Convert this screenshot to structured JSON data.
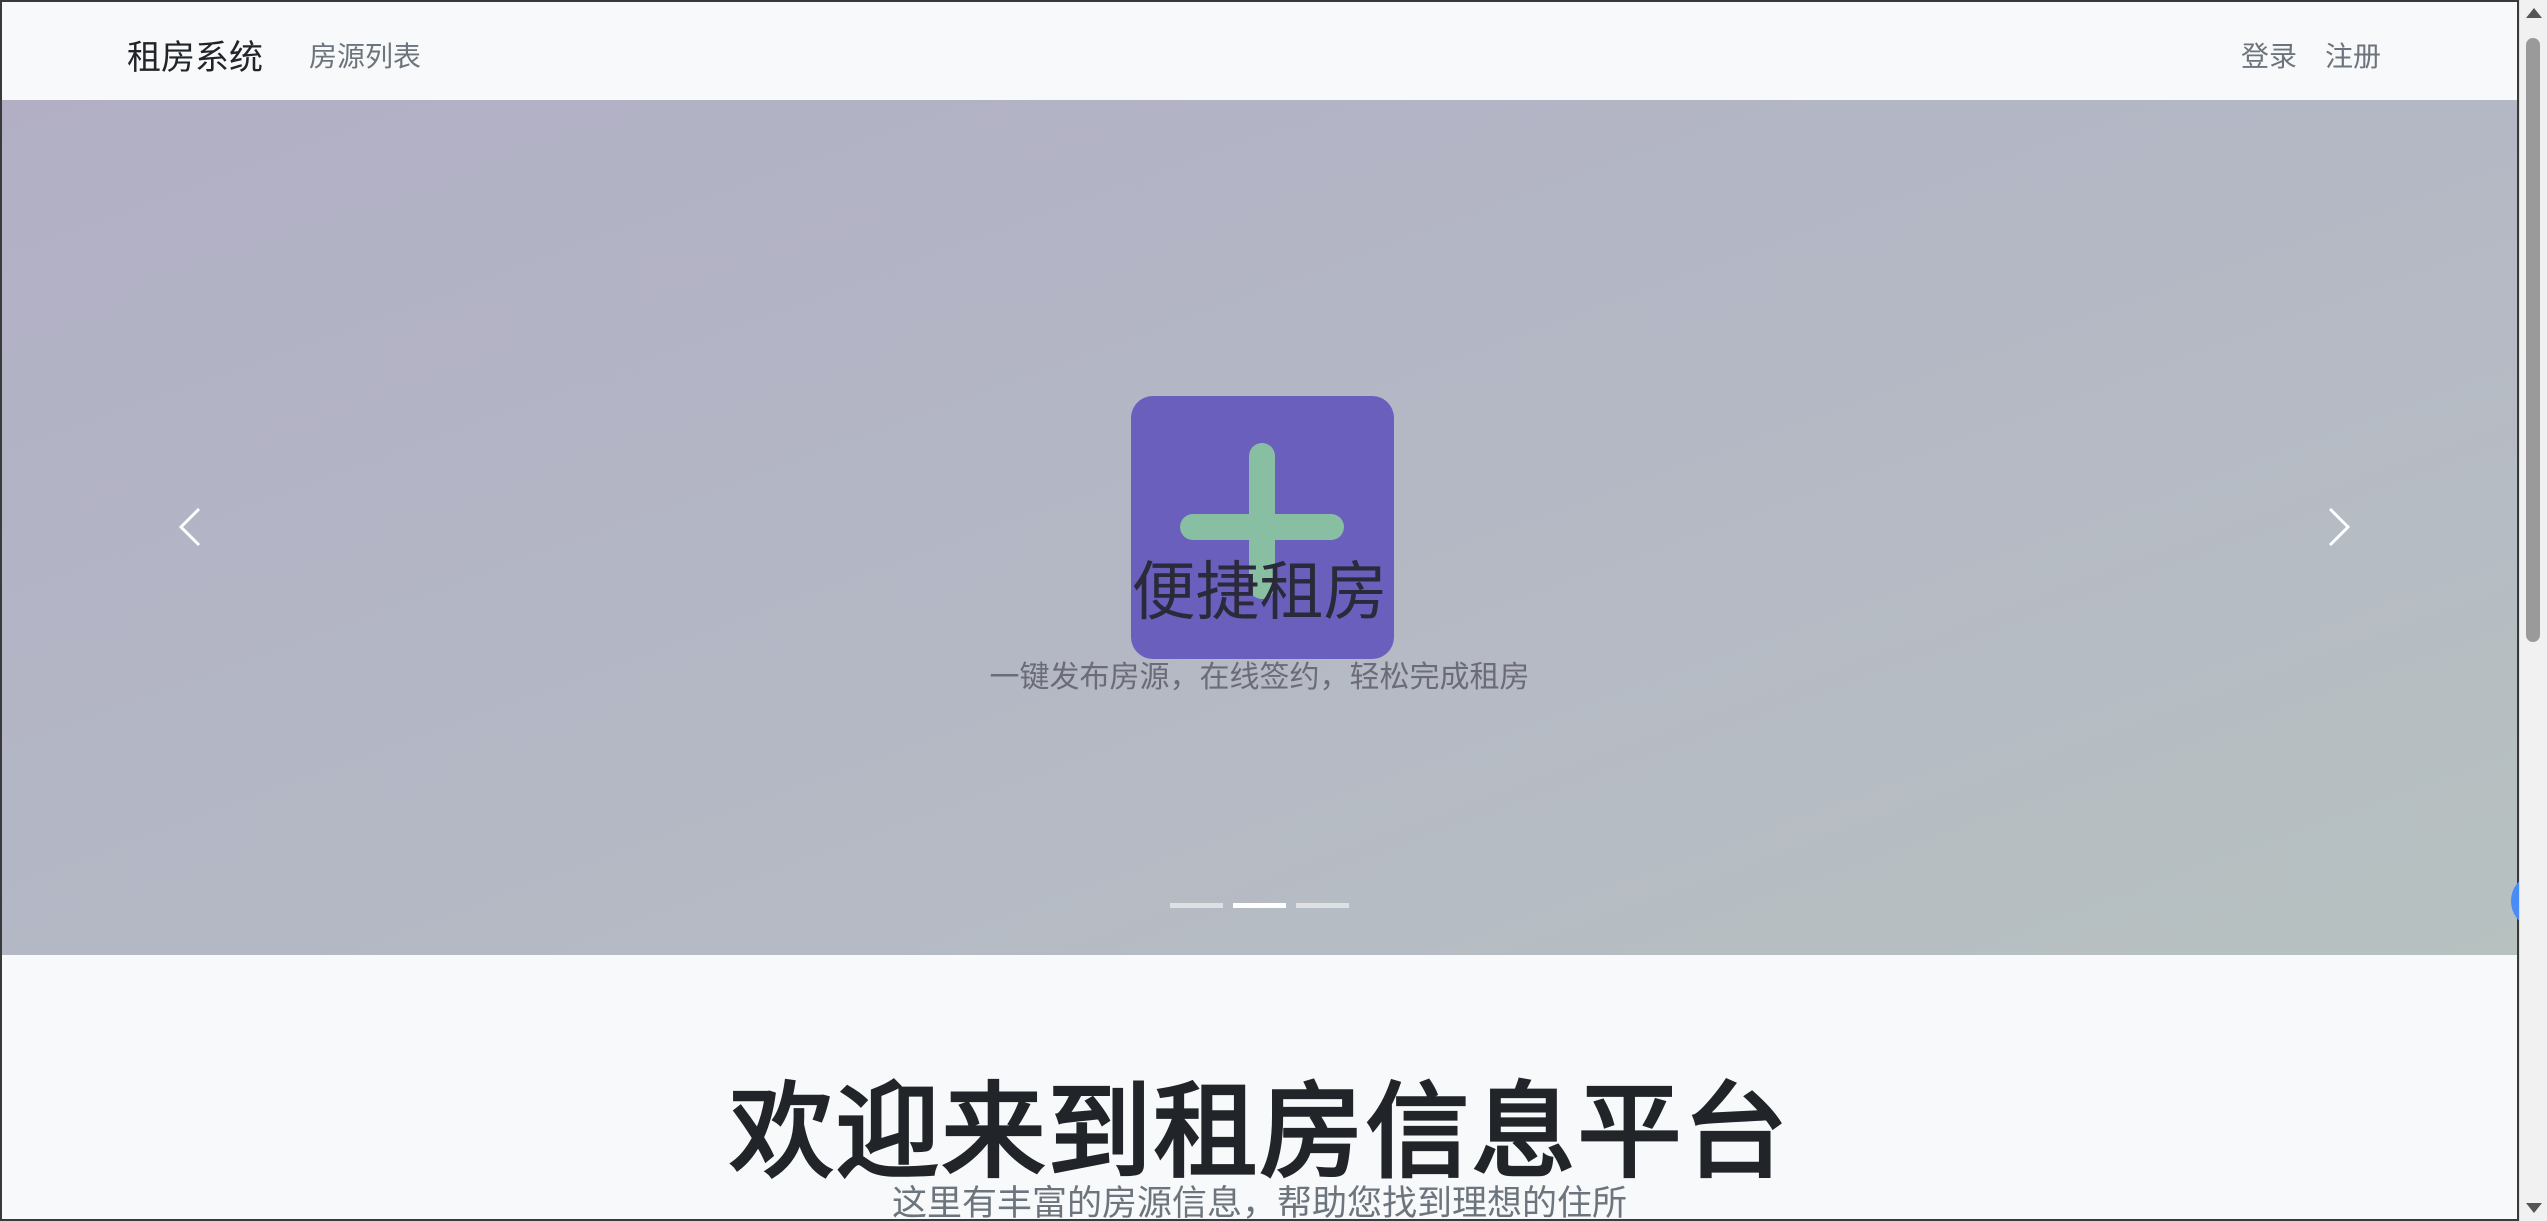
{
  "navbar": {
    "brand": "租房系统",
    "links": {
      "houses": "房源列表",
      "login": "登录",
      "register": "注册"
    }
  },
  "carousel": {
    "active_index": 1,
    "slide_count": 3,
    "slide": {
      "icon": "plus-icon",
      "title": "便捷租房",
      "caption": "一键发布房源，在线签约，轻松完成租房"
    },
    "prev_icon": "chevron-left-icon",
    "next_icon": "chevron-right-icon"
  },
  "welcome": {
    "title": "欢迎来到租房信息平台",
    "subtitle": "这里有丰富的房源信息，帮助您找到理想的住所"
  },
  "side_tab": {
    "icon": "chevron-left-icon",
    "color": "#4a8cf7"
  },
  "colors": {
    "icon_tile": "#6a5fbc",
    "icon_plus": "#88bfa3",
    "page_background": "#f8f9fa"
  }
}
